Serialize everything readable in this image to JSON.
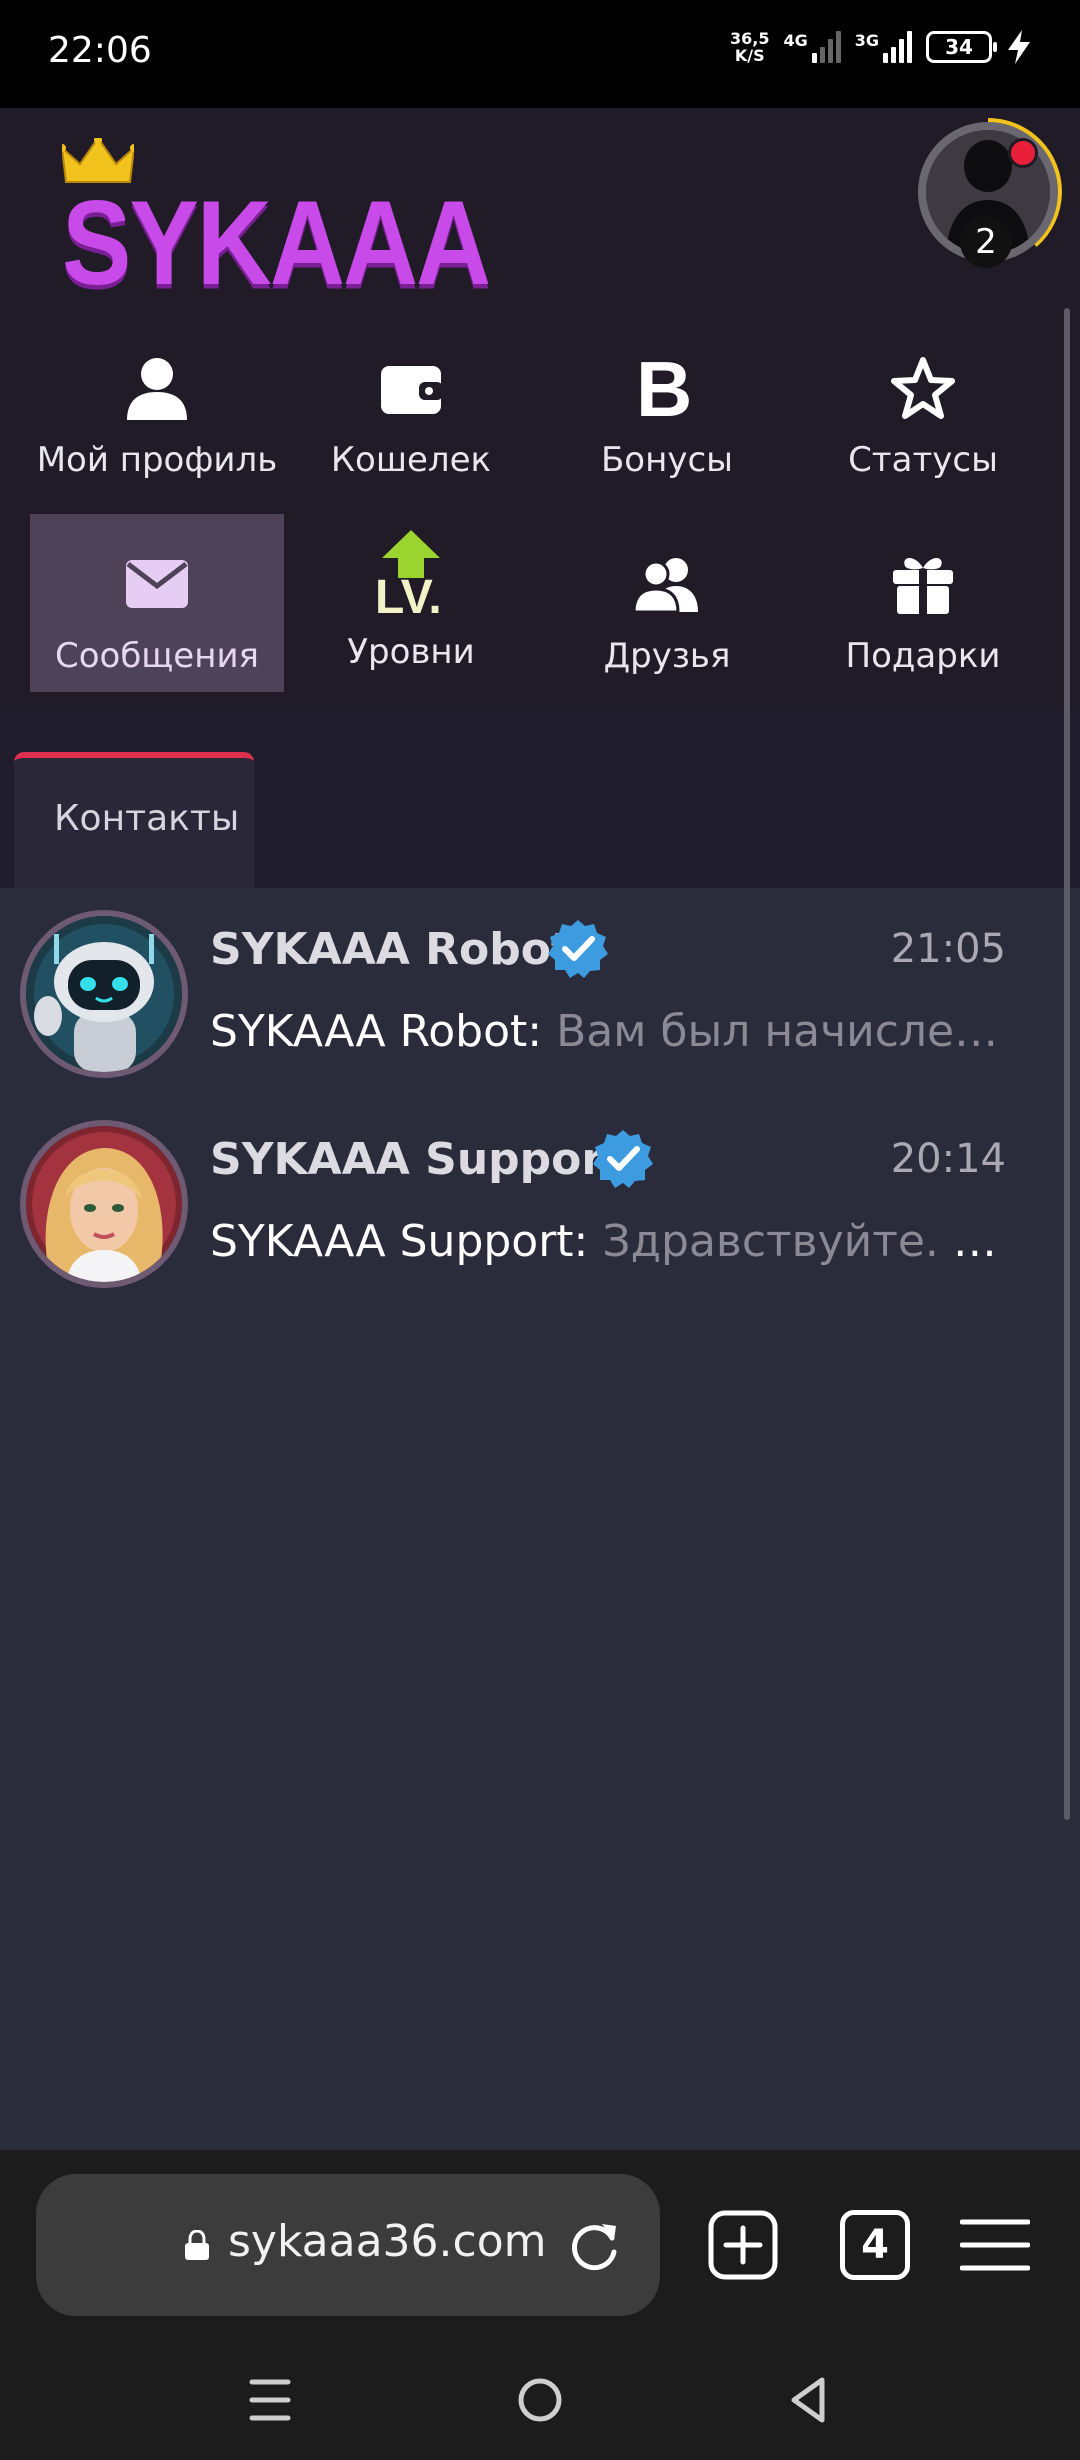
{
  "status_bar": {
    "time": "22:06",
    "net_speed_value": "36,5",
    "net_speed_unit": "K/S",
    "sim1_label": "4G",
    "sim2_label": "3G",
    "battery": "34"
  },
  "header": {
    "logo_text": "SYKAAA",
    "avatar_level": "2"
  },
  "menu": {
    "items": [
      {
        "label": "Мой профиль",
        "icon": "user-icon"
      },
      {
        "label": "Кошелек",
        "icon": "wallet-icon"
      },
      {
        "label": "Бонусы",
        "icon": "bonus-b-icon"
      },
      {
        "label": "Статусы",
        "icon": "star-icon"
      },
      {
        "label": "Сообщения",
        "icon": "envelope-icon",
        "active": true
      },
      {
        "label": "Уровни",
        "icon": "level-up-icon",
        "icon_text": "LV."
      },
      {
        "label": "Друзья",
        "icon": "friends-icon"
      },
      {
        "label": "Подарки",
        "icon": "gift-icon"
      }
    ]
  },
  "tabs": [
    {
      "label": "Контакты",
      "active": true
    }
  ],
  "contacts": [
    {
      "name": "SYKAAA Robot",
      "time": "21:05",
      "sender": "SYKAAA Robot:",
      "message": "Вам был начисле…",
      "verified": true
    },
    {
      "name": "SYKAAA Support",
      "time": "20:14",
      "sender": "SYKAAA Support:",
      "message": "Здравствуйте. Е…",
      "verified": true
    }
  ],
  "browser": {
    "url": "sykaaa36.com",
    "tab_count": "4"
  },
  "colors": {
    "accent_red": "#e0304f",
    "logo_purple": "#c84ae8",
    "verified_blue": "#3d9be0",
    "level_green": "#9bd42e"
  }
}
